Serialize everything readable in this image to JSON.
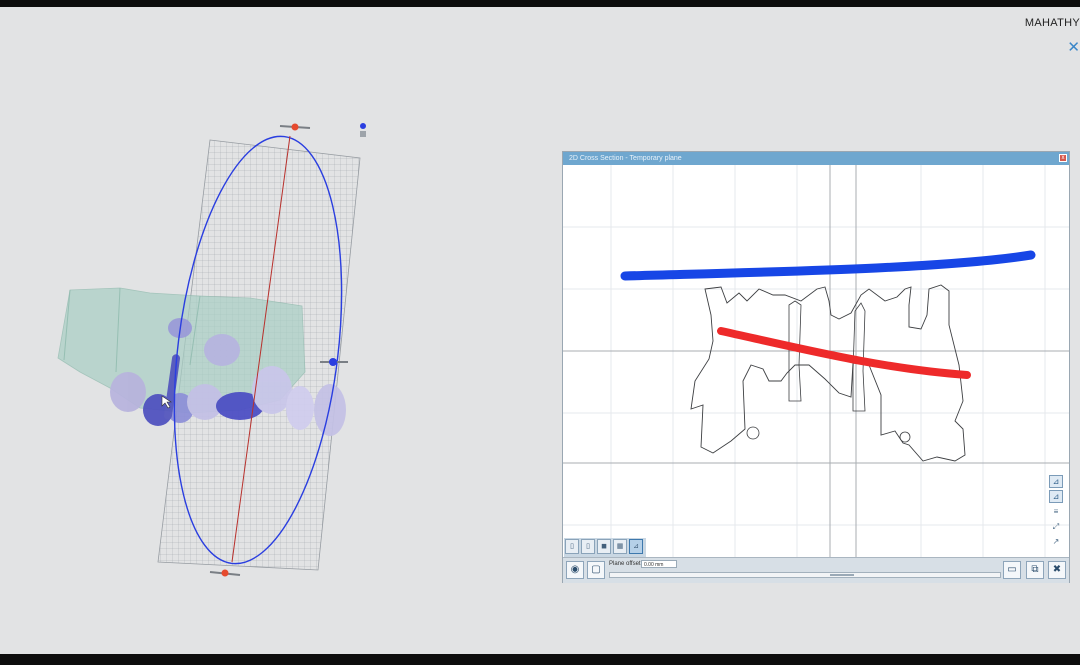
{
  "app": {
    "user_label": "MAHATHY",
    "close_glyph": "✕"
  },
  "dialog": {
    "title": "2D Cross Section - Temporary plane",
    "close_glyph": "x",
    "plane_offset_label": "Plane offset:",
    "plane_offset_value": "0.00 mm",
    "offset_fraction": 0.6
  },
  "toolbar_right": {
    "icons": [
      "section-profile-icon",
      "section-profile-alt-icon",
      "layers-icon",
      "transform-icon",
      "pick-icon"
    ]
  },
  "view_tabs": {
    "icons": [
      "view-front-icon",
      "view-side-icon",
      "view-top-icon",
      "view-3d-icon",
      "view-section-icon"
    ],
    "active_index": 4
  },
  "bottom_bar": {
    "icons": [
      "eye-icon",
      "tooth-icon",
      "export-icon",
      "tooth-copy-icon",
      "tooth-delete-icon"
    ]
  },
  "colors": {
    "annotation_blue": "#1746e6",
    "annotation_red": "#ee2a2a",
    "plane_circle": "#2a3ee0",
    "plane_axis": "#b8302c",
    "dialog_title_bar": "#6fa7cf"
  }
}
